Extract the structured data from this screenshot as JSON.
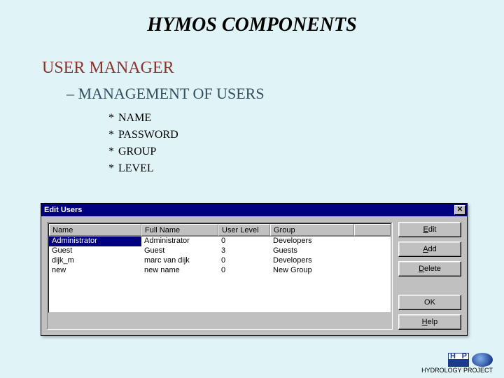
{
  "slide": {
    "title": "HYMOS COMPONENTS",
    "section": "USER MANAGER",
    "subsection_prefix": "–",
    "subsection": "MANAGEMENT OF USERS",
    "bullets": [
      "NAME",
      "PASSWORD",
      "GROUP",
      "LEVEL"
    ]
  },
  "dialog": {
    "title": "Edit Users",
    "close_glyph": "✕",
    "columns": [
      "Name",
      "Full Name",
      "User Level",
      "Group"
    ],
    "rows": [
      {
        "name": "Administrator",
        "full_name": "Administrator",
        "level": "0",
        "group": "Developers",
        "selected": true
      },
      {
        "name": "Guest",
        "full_name": "Guest",
        "level": "3",
        "group": "Guests",
        "selected": false
      },
      {
        "name": "dijk_m",
        "full_name": "marc van dijk",
        "level": "0",
        "group": "Developers",
        "selected": false
      },
      {
        "name": "new",
        "full_name": "new name",
        "level": "0",
        "group": "New Group",
        "selected": false
      }
    ],
    "buttons": {
      "edit": "Edit",
      "add": "Add",
      "delete": "Delete",
      "ok": "OK",
      "help": "Help"
    }
  },
  "footer": {
    "logo_text": "H",
    "caption": "HYDROLOGY PROJECT"
  }
}
